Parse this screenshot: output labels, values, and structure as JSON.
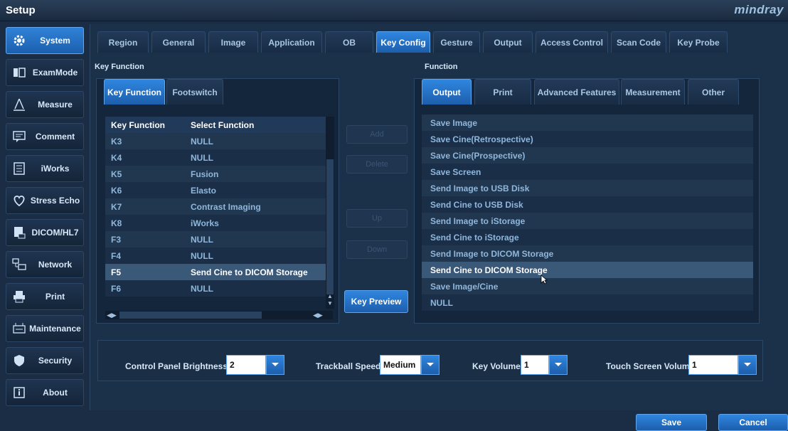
{
  "window": {
    "title": "Setup",
    "brand": "mindray"
  },
  "sidebar": {
    "items": [
      {
        "label": "System",
        "icon": "gear-icon",
        "active": true
      },
      {
        "label": "ExamMode",
        "icon": "exam-mode-icon"
      },
      {
        "label": "Measure",
        "icon": "measure-icon"
      },
      {
        "label": "Comment",
        "icon": "comment-icon"
      },
      {
        "label": "iWorks",
        "icon": "iworks-icon"
      },
      {
        "label": "Stress Echo",
        "icon": "heart-icon"
      },
      {
        "label": "DICOM/HL7",
        "icon": "dicom-icon"
      },
      {
        "label": "Network",
        "icon": "network-icon"
      },
      {
        "label": "Print",
        "icon": "printer-icon"
      },
      {
        "label": "Maintenance",
        "icon": "maintenance-icon"
      },
      {
        "label": "Security",
        "icon": "shield-icon"
      },
      {
        "label": "About",
        "icon": "info-icon"
      }
    ]
  },
  "tabs": [
    {
      "label": "Region"
    },
    {
      "label": "General"
    },
    {
      "label": "Image"
    },
    {
      "label": "Application"
    },
    {
      "label": "OB"
    },
    {
      "label": "Key Config",
      "active": true
    },
    {
      "label": "Gesture"
    },
    {
      "label": "Output"
    },
    {
      "label": "Access Control"
    },
    {
      "label": "Scan Code"
    },
    {
      "label": "Key Probe"
    }
  ],
  "key_function": {
    "section_label": "Key Function",
    "subtabs": [
      {
        "label": "Key Function",
        "active": true
      },
      {
        "label": "Footswitch"
      }
    ],
    "columns": [
      "Key Function",
      "Select Function"
    ],
    "rows": [
      {
        "key": "K3",
        "fn": "NULL"
      },
      {
        "key": "K4",
        "fn": "NULL"
      },
      {
        "key": "K5",
        "fn": "Fusion"
      },
      {
        "key": "K6",
        "fn": "Elasto"
      },
      {
        "key": "K7",
        "fn": "Contrast Imaging"
      },
      {
        "key": "K8",
        "fn": "iWorks"
      },
      {
        "key": "F3",
        "fn": "NULL"
      },
      {
        "key": "F4",
        "fn": "NULL"
      },
      {
        "key": "F5",
        "fn": "Send Cine to DICOM Storage",
        "selected": true
      },
      {
        "key": "F6",
        "fn": "NULL"
      }
    ]
  },
  "actions": {
    "add": "Add",
    "delete": "Delete",
    "up": "Up",
    "down": "Down",
    "key_preview": "Key Preview"
  },
  "function_panel": {
    "section_label": "Function",
    "subtabs": [
      {
        "label": "Output",
        "active": true
      },
      {
        "label": "Print"
      },
      {
        "label": "Advanced Features"
      },
      {
        "label": "Measurement"
      },
      {
        "label": "Other"
      }
    ],
    "items": [
      {
        "label": "Save Image"
      },
      {
        "label": "Save Cine(Retrospective)"
      },
      {
        "label": "Save Cine(Prospective)"
      },
      {
        "label": "Save Screen"
      },
      {
        "label": "Send Image to USB Disk"
      },
      {
        "label": "Send Cine to USB Disk"
      },
      {
        "label": "Send Image to iStorage"
      },
      {
        "label": "Send Cine to iStorage"
      },
      {
        "label": "Send Image to DICOM Storage"
      },
      {
        "label": "Send Cine to DICOM Storage",
        "selected": true
      },
      {
        "label": "Save Image/Cine"
      },
      {
        "label": "NULL"
      }
    ]
  },
  "controls": {
    "brightness": {
      "label": "Control Panel Brightness",
      "value": "2"
    },
    "trackball": {
      "label": "Trackball Speed",
      "value": "Medium"
    },
    "key_volume": {
      "label": "Key Volume",
      "value": "1"
    },
    "touch_volume": {
      "label": "Touch Screen Volume",
      "value": "1"
    }
  },
  "footer": {
    "save": "Save",
    "cancel": "Cancel"
  }
}
